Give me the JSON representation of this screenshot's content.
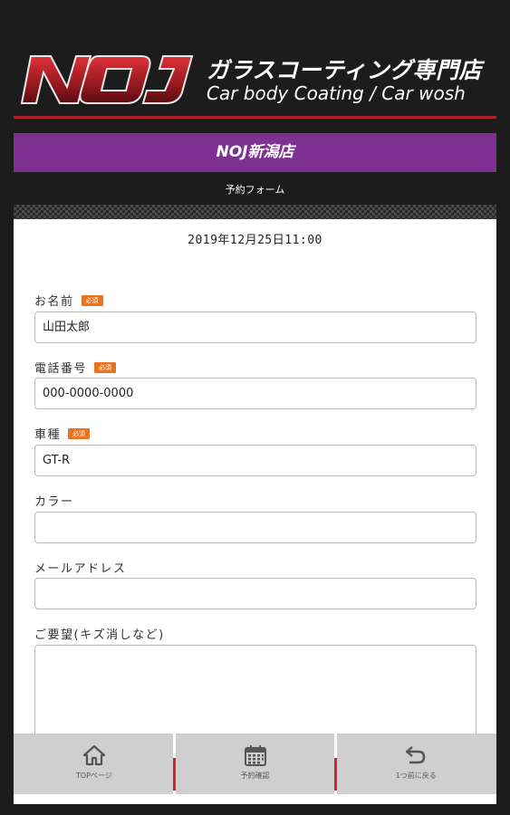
{
  "header": {
    "logo_text": "NOJ",
    "tagline_jp": "ガラスコーティング専門店",
    "tagline_en": "Car body Coating / Car wosh"
  },
  "store_name": "NOJ新潟店",
  "page_subtitle": "予約フォーム",
  "datetime": "2019年12月25日11:00",
  "form": {
    "required_badge": "必須",
    "name": {
      "label": "お名前",
      "value": "山田太郎"
    },
    "phone": {
      "label": "電話番号",
      "value": "000-0000-0000"
    },
    "car_model": {
      "label": "車種",
      "value": "GT-R"
    },
    "color": {
      "label": "カラー",
      "value": ""
    },
    "email": {
      "label": "メールアドレス",
      "value": ""
    },
    "request": {
      "label": "ご要望(キズ消しなど)",
      "value": ""
    }
  },
  "bottom_nav": {
    "top": {
      "label": "TOPページ",
      "icon": "home-icon"
    },
    "confirm": {
      "label": "予約確認",
      "icon": "calendar-icon"
    },
    "back": {
      "label": "1つ前に戻る",
      "icon": "return-icon"
    }
  },
  "colors": {
    "background": "#1c1c1c",
    "accent_purple": "#7e3192",
    "accent_red": "#b3202b",
    "required_orange": "#e8741f"
  }
}
